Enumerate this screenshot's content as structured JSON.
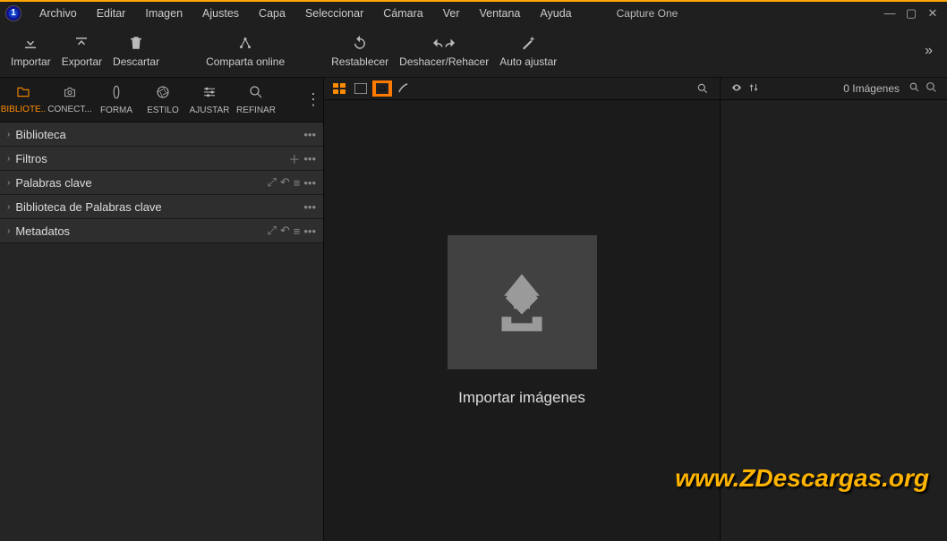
{
  "app_title": "Capture One",
  "logo_text": "1",
  "menu": [
    "Archivo",
    "Editar",
    "Imagen",
    "Ajustes",
    "Capa",
    "Seleccionar",
    "Cámara",
    "Ver",
    "Ventana",
    "Ayuda"
  ],
  "window_controls": {
    "min": "—",
    "max": "▢",
    "close": "✕"
  },
  "toolbar": [
    {
      "id": "import",
      "label": "Importar"
    },
    {
      "id": "export",
      "label": "Exportar"
    },
    {
      "id": "discard",
      "label": "Descartar"
    },
    {
      "id": "share",
      "label": "Comparta online"
    },
    {
      "id": "reset",
      "label": "Restablecer"
    },
    {
      "id": "undoredo",
      "label": "Deshacer/Rehacer"
    },
    {
      "id": "autoadjust",
      "label": "Auto ajustar"
    }
  ],
  "tooltabs": [
    {
      "id": "biblioteca",
      "label": "BIBLIOTE..",
      "active": true
    },
    {
      "id": "conectar",
      "label": "CONECT..."
    },
    {
      "id": "forma",
      "label": "FORMA"
    },
    {
      "id": "estilo",
      "label": "ESTILO"
    },
    {
      "id": "ajustar",
      "label": "AJUSTAR"
    },
    {
      "id": "refinar",
      "label": "REFINAR"
    }
  ],
  "panels": [
    {
      "label": "Biblioteca",
      "actions": [
        "dots"
      ]
    },
    {
      "label": "Filtros",
      "actions": [
        "plus",
        "dots"
      ]
    },
    {
      "label": "Palabras clave",
      "actions": [
        "expand",
        "undo",
        "list",
        "dots"
      ]
    },
    {
      "label": "Biblioteca de Palabras clave",
      "actions": [
        "dots"
      ]
    },
    {
      "label": "Metadatos",
      "actions": [
        "expand",
        "undo",
        "list",
        "dots"
      ]
    }
  ],
  "viewer": {
    "cta": "Importar imágenes"
  },
  "rightbar": {
    "count_text": "0 Imágenes"
  },
  "watermark": "www.ZDescargas.org"
}
